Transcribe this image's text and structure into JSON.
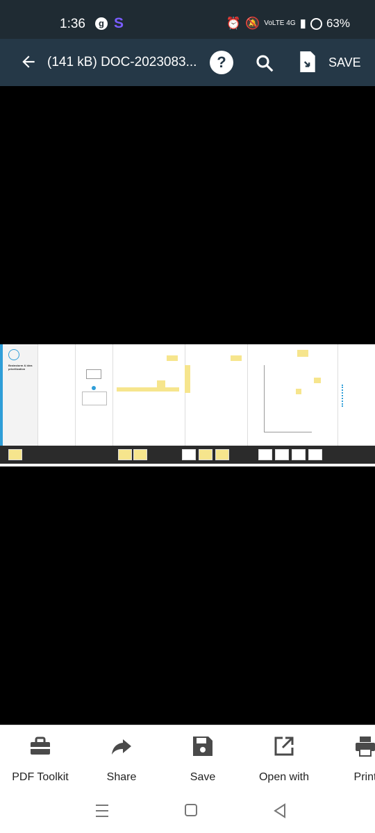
{
  "status": {
    "time": "1:36",
    "g_badge": "g",
    "s_badge": "S",
    "network": "VoLTE 4G",
    "battery": "63%"
  },
  "appbar": {
    "title": "(141 kB) DOC-2023083...",
    "help": "?",
    "save_label": "SAVE"
  },
  "document": {
    "title_text": "Brainstorm & idea prioritization"
  },
  "bottom": {
    "tools": [
      {
        "label": "PDF Toolkit",
        "icon": "toolkit-icon"
      },
      {
        "label": "Share",
        "icon": "share-icon"
      },
      {
        "label": "Save",
        "icon": "save-icon"
      },
      {
        "label": "Open with",
        "icon": "open-with-icon"
      },
      {
        "label": "Print",
        "icon": "print-icon"
      }
    ]
  },
  "colors": {
    "status_bg": "#1f2b33",
    "appbar_bg": "#253847",
    "accent_blue": "#2f9ed8",
    "sticky_yellow": "#f6e58d"
  }
}
